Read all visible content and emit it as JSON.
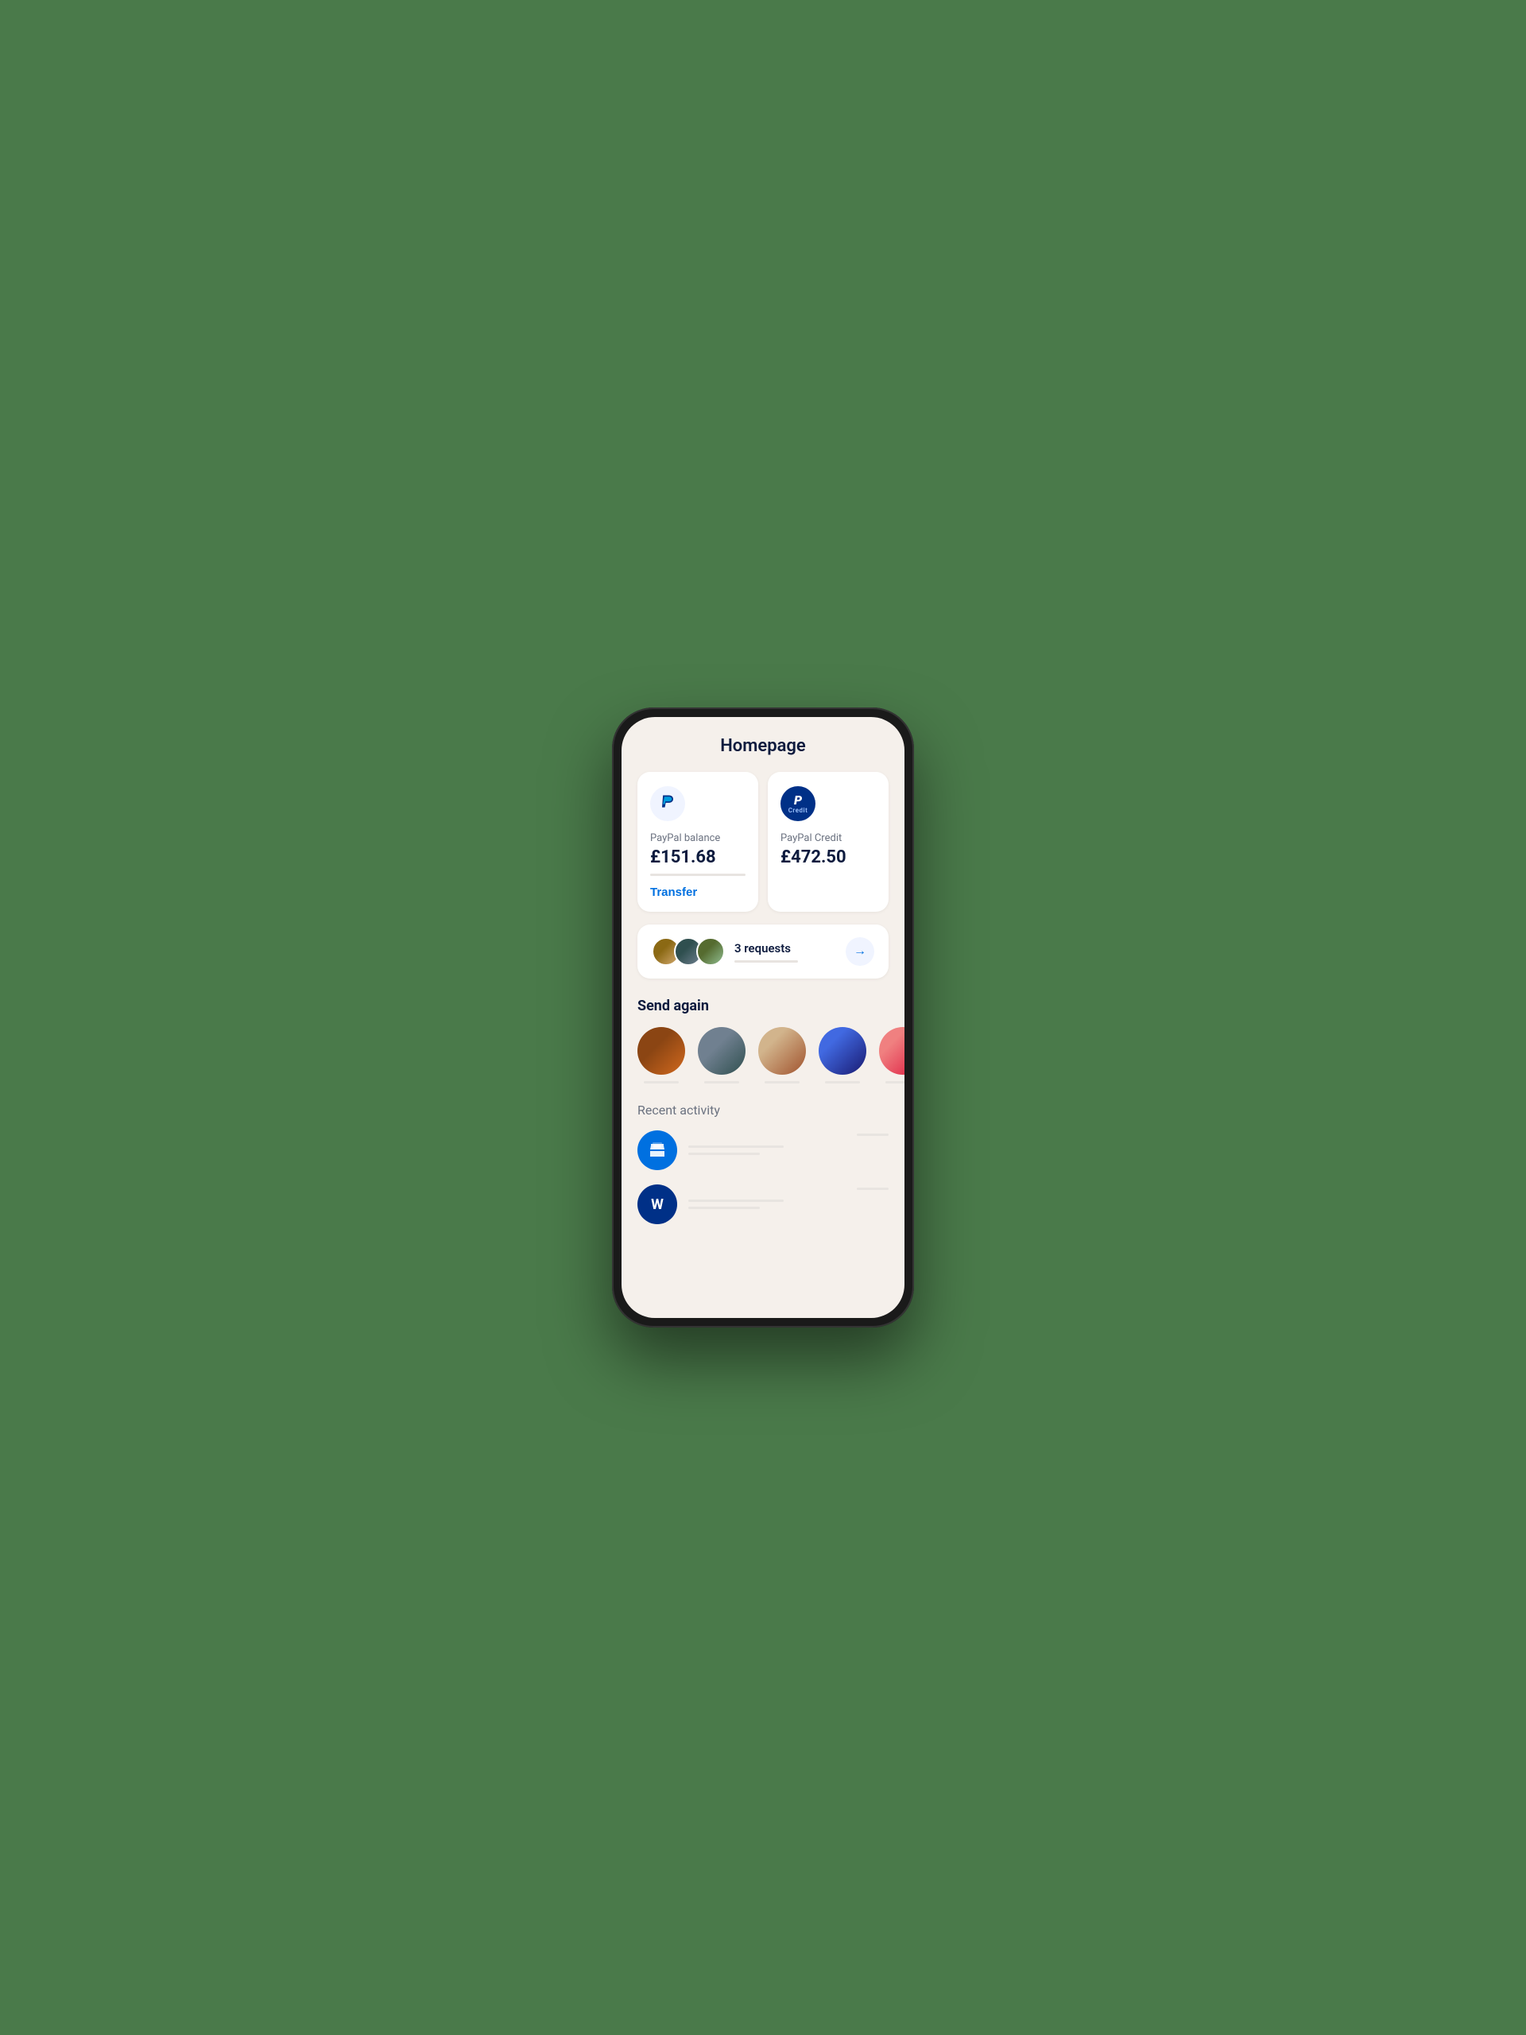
{
  "page": {
    "title": "Homepage",
    "background": "#4a7a4a"
  },
  "balance_cards": [
    {
      "id": "paypal-balance",
      "logo_type": "plain",
      "label": "PayPal balance",
      "amount": "£151.68",
      "has_transfer": true,
      "transfer_label": "Transfer"
    },
    {
      "id": "paypal-credit",
      "logo_type": "credit",
      "label": "PayPal Credit",
      "amount": "£472.50",
      "credit_text": "Credit",
      "has_transfer": false
    }
  ],
  "requests": {
    "count_label": "3 requests",
    "arrow": "→"
  },
  "send_again": {
    "title": "Send again",
    "people": [
      {
        "id": 1,
        "css_class": "avatar-person-1"
      },
      {
        "id": 2,
        "css_class": "avatar-person-2"
      },
      {
        "id": 3,
        "css_class": "avatar-person-3"
      },
      {
        "id": 4,
        "css_class": "avatar-person-4"
      },
      {
        "id": 5,
        "css_class": "avatar-person-5"
      }
    ]
  },
  "recent_activity": {
    "title": "Recent activity",
    "items": [
      {
        "id": 1,
        "icon_type": "store",
        "icon_bg": "#0070e0"
      },
      {
        "id": 2,
        "icon_type": "letter",
        "icon_bg": "#003087",
        "letter": "W"
      }
    ]
  }
}
